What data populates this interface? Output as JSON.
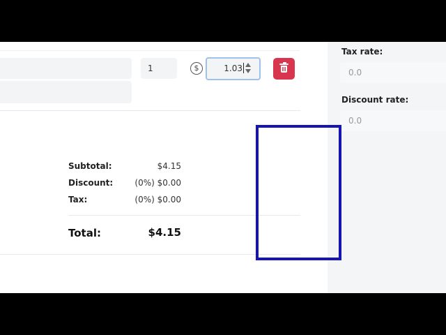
{
  "line_item": {
    "quantity": "1",
    "currency_symbol": "$",
    "unit_price": "1.03"
  },
  "summary": {
    "subtotal_label": "Subtotal:",
    "subtotal_value": "$4.15",
    "discount_label": "Discount:",
    "discount_value": "(0%) $0.00",
    "tax_label": "Tax:",
    "tax_value": "(0%) $0.00",
    "total_label": "Total:",
    "total_value": "$4.15"
  },
  "sidebar": {
    "tax_rate_label": "Tax rate:",
    "tax_rate_value": "0.0",
    "discount_rate_label": "Discount rate:",
    "discount_rate_value": "0.0"
  },
  "colors": {
    "delete_button": "#d8364e",
    "highlight_box": "#1515b4",
    "focus_ring": "#9ec2ec"
  }
}
